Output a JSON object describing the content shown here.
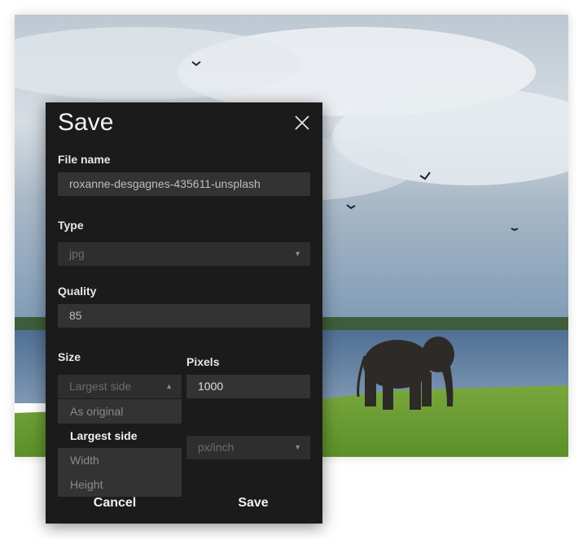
{
  "dialog": {
    "title": "Save",
    "close_icon": "close-icon",
    "file_name": {
      "label": "File name",
      "value": "roxanne-desgagnes-435611-unsplash"
    },
    "type": {
      "label": "Type",
      "value": "jpg"
    },
    "quality": {
      "label": "Quality",
      "value": "85"
    },
    "size": {
      "label": "Size",
      "value": "Largest side",
      "options": [
        "As original",
        "Largest side",
        "Width",
        "Height"
      ],
      "selected": "Largest side"
    },
    "pixels": {
      "label": "Pixels",
      "value": "1000"
    },
    "resolution_unit": {
      "value": "px/inch"
    },
    "cancel_label": "Cancel",
    "save_label": "Save"
  },
  "colors": {
    "dialog_bg": "#1b1b1b",
    "field_bg": "#333333",
    "text": "#e6e6e6",
    "muted_text": "#8a8a8a"
  }
}
